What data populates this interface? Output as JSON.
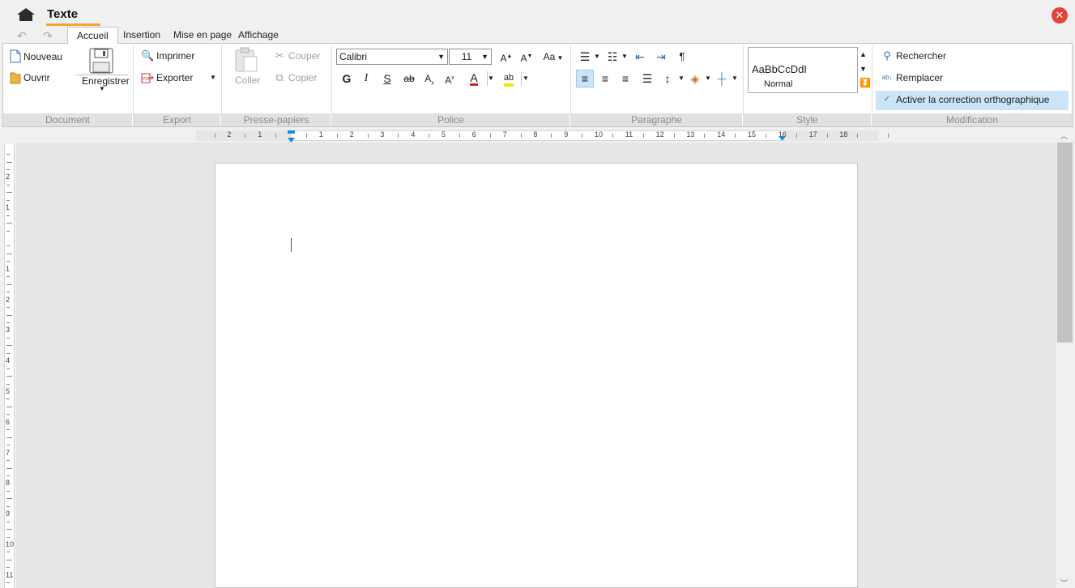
{
  "titlebar": {
    "title": "Texte"
  },
  "tabs": [
    {
      "label": "Accueil",
      "active": true
    },
    {
      "label": "Insertion"
    },
    {
      "label": "Mise en page"
    },
    {
      "label": "Affichage"
    }
  ],
  "groups": {
    "document": "Document",
    "export": "Export",
    "clipboard": "Presse-papiers",
    "font": "Police",
    "paragraph": "Paragraphe",
    "style": "Style",
    "modification": "Modification"
  },
  "document": {
    "new": "Nouveau",
    "open": "Ouvrir",
    "save": "Enregistrer"
  },
  "export": {
    "print": "Imprimer",
    "export": "Exporter"
  },
  "clipboard": {
    "paste": "Coller",
    "cut": "Couper",
    "copy": "Copier"
  },
  "font": {
    "family": "Calibri",
    "size": "11",
    "case_label": "Aa",
    "bold": "G",
    "italic": "I",
    "underline": "S",
    "strike": "ab"
  },
  "style": {
    "preview": "AaBbCcDdI",
    "name": "Normal"
  },
  "modification": {
    "find": "Rechercher",
    "replace": "Remplacer",
    "spellcheck": "Activer la correction orthographique"
  },
  "ruler": {
    "h_labels": [
      "2",
      "1",
      "1",
      "2",
      "3",
      "4",
      "5",
      "6",
      "7",
      "8",
      "9",
      "10",
      "11",
      "12",
      "13",
      "14",
      "15",
      "16",
      "17",
      "18"
    ],
    "v_labels": [
      "2",
      "1",
      "1",
      "2",
      "3",
      "4",
      "5",
      "6",
      "7",
      "8",
      "9",
      "10",
      "11"
    ]
  },
  "colors": {
    "accent": "#f3a53c",
    "close": "#e2443a",
    "highlight": "#cce4f7",
    "indent_marker": "#1e8ad6"
  }
}
